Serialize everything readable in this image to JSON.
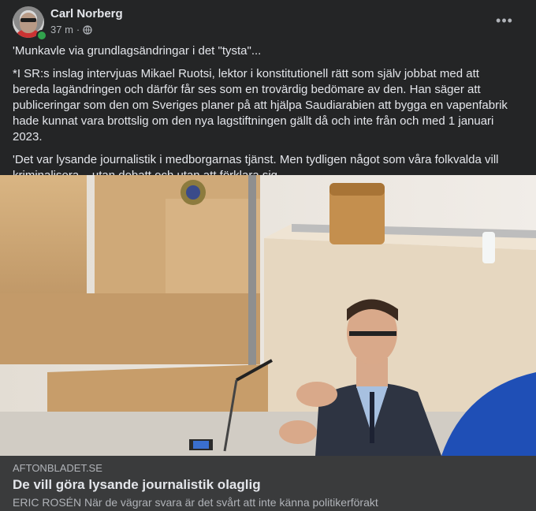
{
  "post": {
    "author": "Carl Norberg",
    "time": "37 m",
    "privacy_icon": "globe-icon",
    "more_icon": "•••",
    "paragraphs": [
      "'Munkavle via grundlagsändringar i det \"tysta\"...",
      "*I SR:s inslag intervjuas Mikael Ruotsi, lektor i konstitutionell rätt som själv jobbat med att bereda lagändringen och därför får ses som en trovärdig bedömare av den. Han säger att publiceringar som den om Sveriges planer på att hjälpa Saudiarabien att bygga en vapenfabrik hade kunnat vara brottslig om den nya lagstiftningen gällt då och inte från och med 1 januari 2023.",
      "'Det var lysande journalistik i medborgarnas tjänst. Men tydligen något som våra folkvalda vill kriminalisera – utan debatt och utan att förklara sig."
    ]
  },
  "link": {
    "domain": "AFTONBLADET.SE",
    "title": "De vill göra lysande journalistik olaglig",
    "description": "ERIC ROSÉN När de vägrar svara är det svårt att inte känna politikerförakt"
  },
  "colors": {
    "background": "#242526",
    "link_footer": "#3a3b3c",
    "text_primary": "#e4e6eb",
    "text_secondary": "#b0b3b8",
    "online": "#31a24c"
  }
}
